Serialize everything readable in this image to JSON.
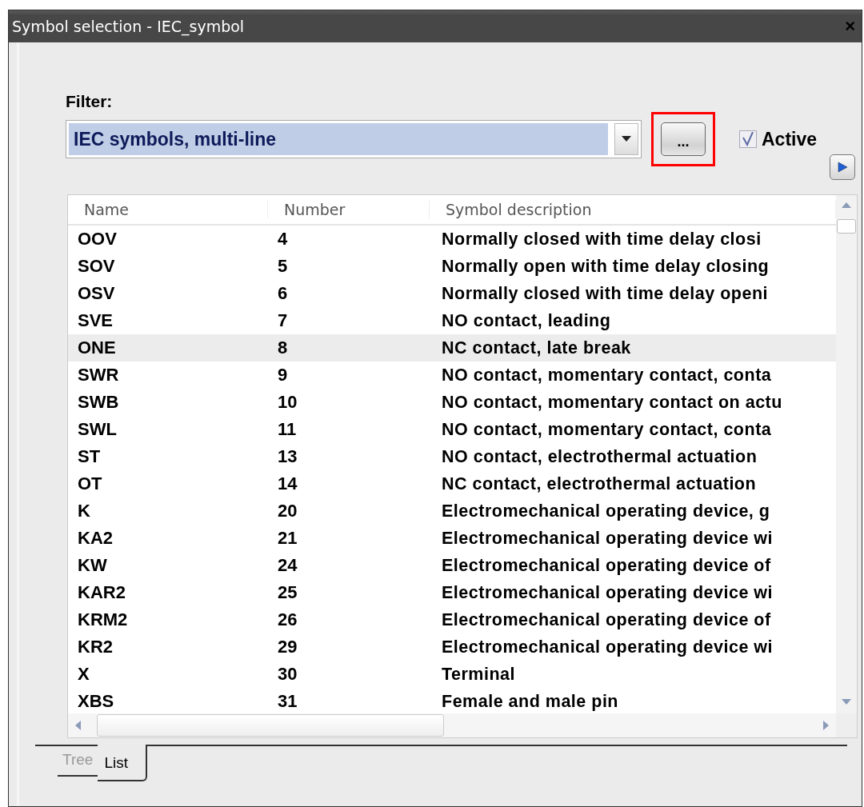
{
  "window": {
    "title": "Symbol selection - IEC_symbol",
    "close": "×"
  },
  "filter": {
    "label": "Filter:",
    "value": "IEC symbols, multi-line",
    "browse_button": "...",
    "highlighted": true,
    "active": {
      "label": "Active",
      "checked": true
    }
  },
  "table": {
    "columns": [
      "Name",
      "Number",
      "Symbol description"
    ],
    "rows": [
      {
        "name": "OOV",
        "number": "4",
        "description": "Normally closed with time delay closi",
        "selected": false
      },
      {
        "name": "SOV",
        "number": "5",
        "description": "Normally open with time delay closing",
        "selected": false
      },
      {
        "name": "OSV",
        "number": "6",
        "description": "Normally closed with time delay openi",
        "selected": false
      },
      {
        "name": "SVE",
        "number": "7",
        "description": "NO contact, leading",
        "selected": false
      },
      {
        "name": "ONE",
        "number": "8",
        "description": "NC contact, late break",
        "selected": true
      },
      {
        "name": "SWR",
        "number": "9",
        "description": "NO contact, momentary contact, conta",
        "selected": false
      },
      {
        "name": "SWB",
        "number": "10",
        "description": "NO contact, momentary contact on actu",
        "selected": false
      },
      {
        "name": "SWL",
        "number": "11",
        "description": "NO contact, momentary contact, conta",
        "selected": false
      },
      {
        "name": "ST",
        "number": "13",
        "description": "NO contact, electrothermal actuation",
        "selected": false
      },
      {
        "name": "OT",
        "number": "14",
        "description": "NC contact, electrothermal actuation",
        "selected": false
      },
      {
        "name": "K",
        "number": "20",
        "description": "Electromechanical operating device, g",
        "selected": false
      },
      {
        "name": "KA2",
        "number": "21",
        "description": "Electromechanical operating device wi",
        "selected": false
      },
      {
        "name": "KW",
        "number": "24",
        "description": "Electromechanical operating device of",
        "selected": false
      },
      {
        "name": "KAR2",
        "number": "25",
        "description": "Electromechanical operating device wi",
        "selected": false
      },
      {
        "name": "KRM2",
        "number": "26",
        "description": "Electromechanical operating device of",
        "selected": false
      },
      {
        "name": "KR2",
        "number": "29",
        "description": "Electromechanical operating device wi",
        "selected": false
      },
      {
        "name": "X",
        "number": "30",
        "description": "Terminal",
        "selected": false
      },
      {
        "name": "XBS",
        "number": "31",
        "description": "Female and male pin",
        "selected": false
      }
    ]
  },
  "tabs": [
    {
      "label": "Tree",
      "selected": false
    },
    {
      "label": "List",
      "selected": true
    }
  ]
}
